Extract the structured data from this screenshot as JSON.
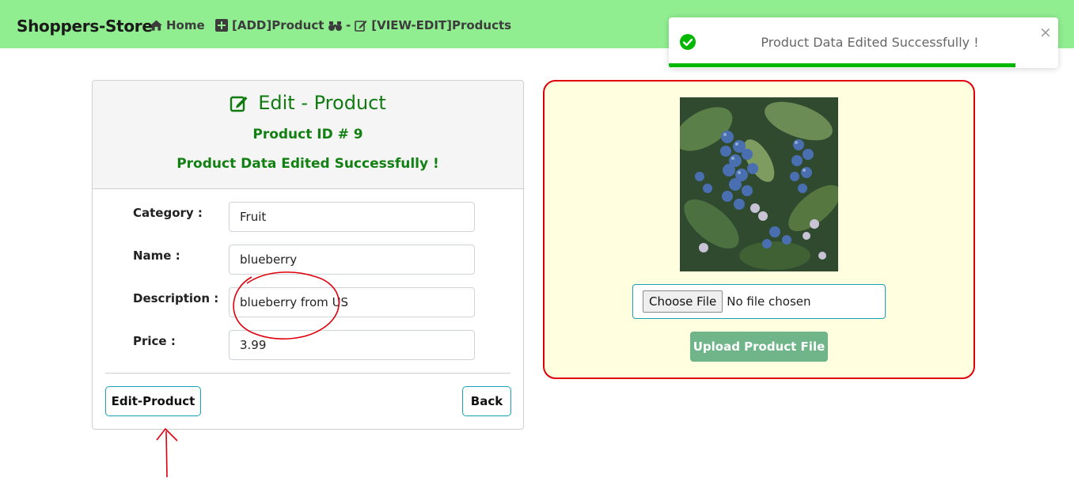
{
  "navbar": {
    "brand": "Shoppers-Store",
    "links": [
      {
        "label": "Home",
        "icon": "home-icon"
      },
      {
        "label": "[ADD]Product",
        "icon": "plus-square-icon"
      },
      {
        "label": "[VIEW-EDIT]Products",
        "icon": "binoculars-edit-icon"
      }
    ],
    "view_separator": "-"
  },
  "edit_card": {
    "title": "Edit - Product",
    "title_icon": "edit-icon",
    "product_id": "Product ID # 9",
    "success_message": "Product Data Edited Successfully !",
    "fields": [
      {
        "label": "Category :",
        "value": "Fruit"
      },
      {
        "label": "Name :",
        "value": "blueberry"
      },
      {
        "label": "Description :",
        "value": "blueberry from US"
      },
      {
        "label": "Price :",
        "value": "3.99"
      }
    ],
    "edit_button": "Edit-Product",
    "back_button": "Back"
  },
  "upload_card": {
    "image": "blueberry-photo",
    "choose_file_button": "Choose File",
    "file_status": "No file chosen",
    "upload_button": "Upload Product File"
  },
  "toast": {
    "message": "Product Data Edited Successfully !",
    "icon": "check-circle-icon",
    "close": "×",
    "progress": 0.89
  },
  "colors": {
    "navbar_bg": "#90ee90",
    "success_green": "#128012",
    "upload_border": "#e0000c",
    "upload_bg": "#ffffe0",
    "button_outline": "#17a2b8",
    "upload_button": "#6fb589",
    "toast_progress": "#00b800",
    "annotation_red": "#e0000c"
  }
}
